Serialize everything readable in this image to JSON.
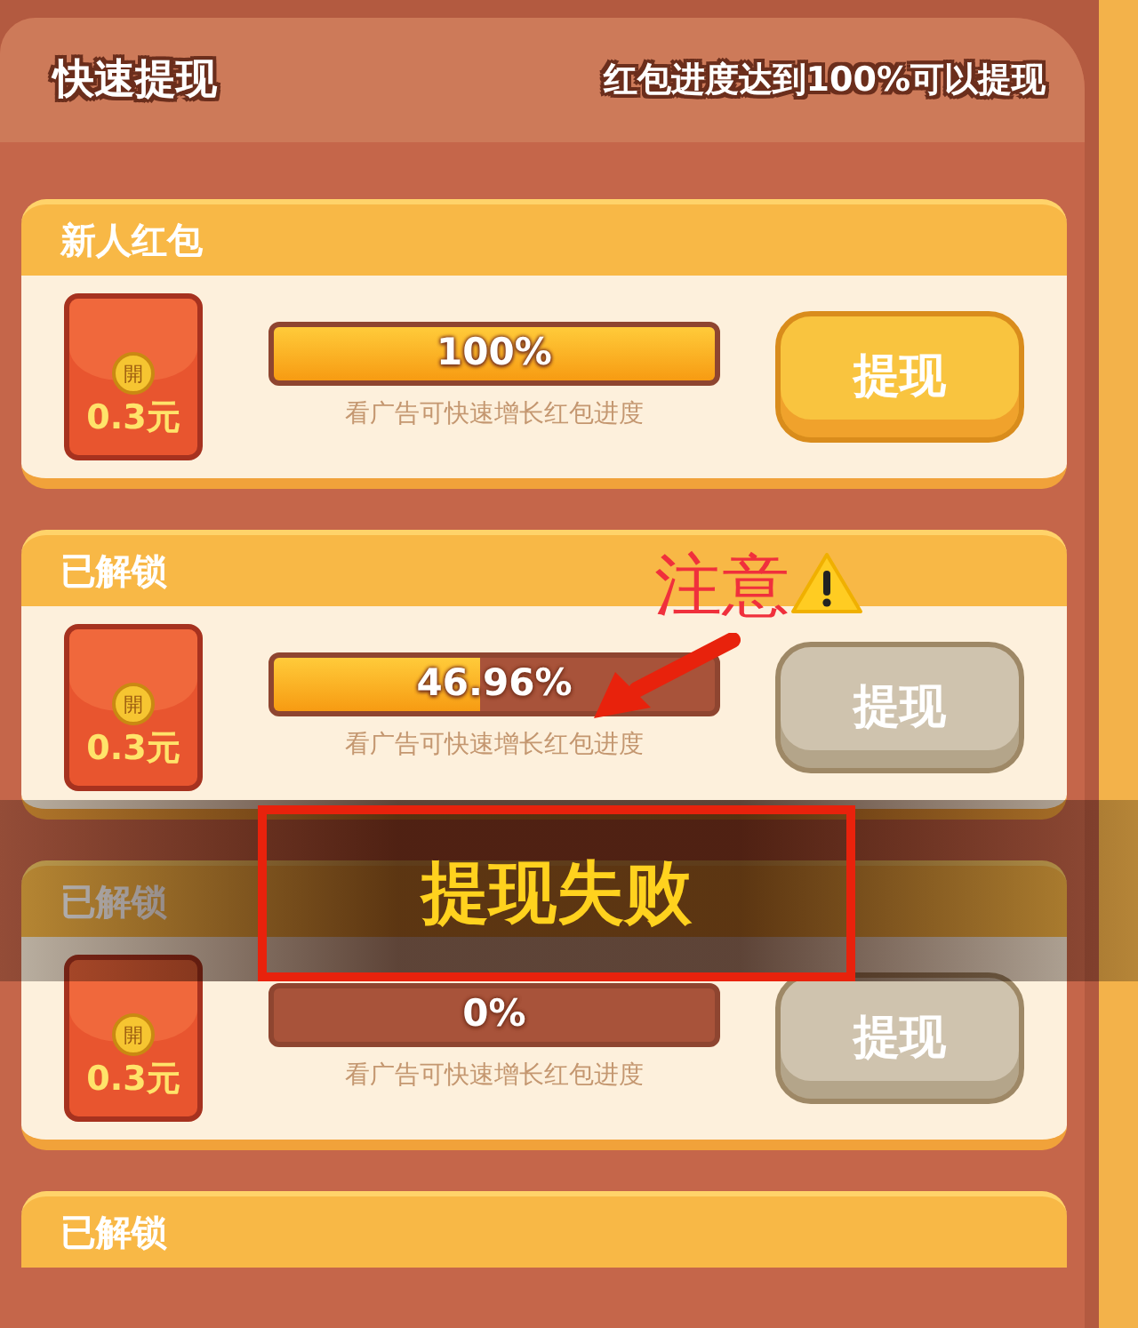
{
  "header": {
    "title": "快速提现",
    "note": "红包进度达到100%可以提现"
  },
  "cards": [
    {
      "title": "新人红包",
      "envelope": {
        "coin": "開",
        "amount": "0.3元"
      },
      "progress": {
        "level": 1,
        "reading": "100%"
      },
      "hint": "看广告可快速增长红包进度",
      "button": {
        "label": "提现",
        "disabled": false
      }
    },
    {
      "title": "已解锁",
      "envelope": {
        "coin": "開",
        "amount": "0.3元"
      },
      "progress": {
        "level": 0.4696,
        "reading": "46.96%"
      },
      "hint": "看广告可快速增长红包进度",
      "button": {
        "label": "提现",
        "disabled": true
      }
    },
    {
      "title": "已解锁",
      "envelope": {
        "coin": "開",
        "amount": "0.3元"
      },
      "progress": {
        "level": 0,
        "reading": "0%"
      },
      "hint": "看广告可快速增长红包进度",
      "button": {
        "label": "提现",
        "disabled": true
      }
    },
    {
      "title": "已解锁"
    }
  ],
  "annotation": {
    "text": "注意"
  },
  "toast": {
    "message": "提现失败"
  }
}
